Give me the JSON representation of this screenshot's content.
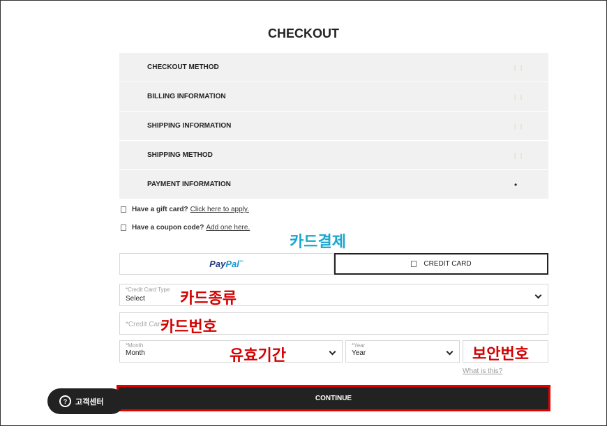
{
  "title": "CHECKOUT",
  "steps": [
    {
      "label": "CHECKOUT METHOD",
      "mark": "| |"
    },
    {
      "label": "BILLING INFORMATION",
      "mark": "| |"
    },
    {
      "label": "SHIPPING INFORMATION",
      "mark": "| |"
    },
    {
      "label": "SHIPPING METHOD",
      "mark": "| |"
    },
    {
      "label": "PAYMENT INFORMATION",
      "mark": "•"
    }
  ],
  "gift": {
    "label": "Have a gift card?",
    "link": "Click here to apply."
  },
  "coupon": {
    "label": "Have a coupon code?",
    "link": "Add one here."
  },
  "payment": {
    "paypal_pay": "Pay",
    "paypal_pal": "Pal",
    "paypal_tm": "™",
    "credit_card": "CREDIT CARD"
  },
  "form": {
    "card_type": {
      "label": "*Credit Card Type",
      "value": "Select"
    },
    "card_number": {
      "placeholder": "*Credit Card"
    },
    "month": {
      "label": "*Month",
      "value": "Month"
    },
    "year": {
      "label": "*Year",
      "value": "Year"
    },
    "what_is_this": "What is this?"
  },
  "continue": "CONTINUE",
  "customer_center": "고객센터",
  "annotations": {
    "card_payment": "카드결제",
    "card_type": "카드종류",
    "card_number": "카드번호",
    "expiry": "유효기간",
    "security_code": "보안번호"
  },
  "colors": {
    "annotation_blue": "#1aa7cf",
    "annotation_red": "#d40000",
    "highlight_border": "#e00000",
    "paypal_dark": "#263b80",
    "paypal_light": "#179bd7"
  }
}
